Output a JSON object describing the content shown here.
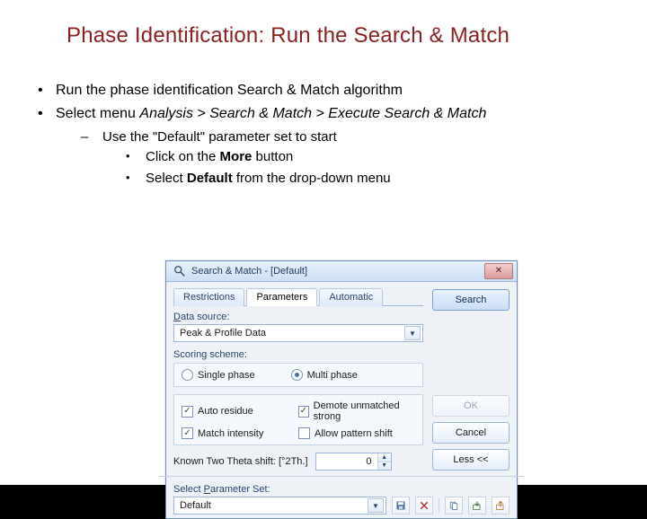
{
  "title": "Phase Identification: Run the Search & Match",
  "bullets": {
    "b1": "Run the phase identification Search & Match algorithm",
    "b2_pre": "Select menu ",
    "b2_italic": "Analysis > Search & Match > Execute Search & Match",
    "sub1": "Use the \"Default\" parameter set to start",
    "sub2_pre": "Click on the ",
    "sub2_bold": "More",
    "sub2_post": " button",
    "sub3_pre": "Select ",
    "sub3_bold": "Default",
    "sub3_post": " from the drop-down menu"
  },
  "dialog": {
    "title": "Search & Match - [Default]",
    "tabs": {
      "t0": "Restrictions",
      "t1": "Parameters",
      "t2": "Automatic"
    },
    "data_source_label": "Data source:",
    "data_source_value": "Peak & Profile Data",
    "scoring_label": "Scoring scheme:",
    "radio_single": "Single phase",
    "radio_multi": "Multi phase",
    "chk_auto_residue": "Auto residue",
    "chk_demote": "Demote unmatched strong",
    "chk_match_intensity": "Match intensity",
    "chk_pattern_shift": "Allow pattern shift",
    "two_theta_label": "Known Two Theta shift: [°2Th.]",
    "two_theta_value": "0",
    "buttons": {
      "search": "Search",
      "ok": "OK",
      "cancel": "Cancel",
      "less": "Less <<"
    },
    "param_set_label": "Select Parameter Set:",
    "param_set_value": "Default",
    "toolbar": {
      "save": "save-icon",
      "delete": "delete-icon",
      "copy": "copy-icon",
      "import": "import-icon",
      "export": "export-icon"
    }
  }
}
